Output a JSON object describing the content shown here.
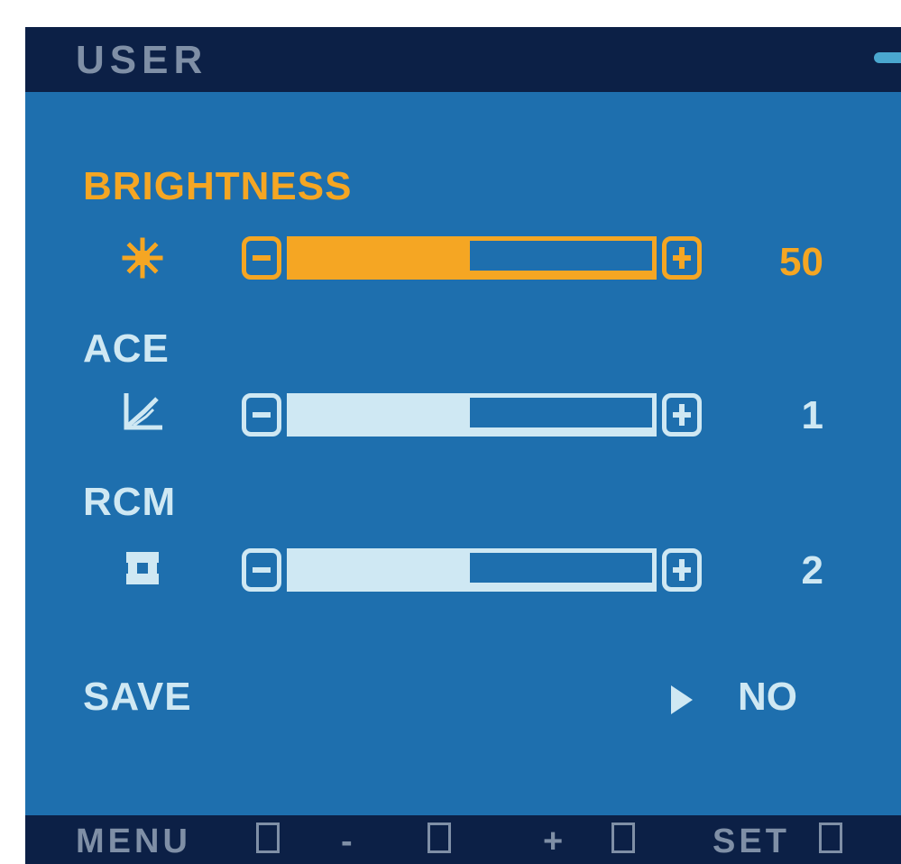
{
  "header": {
    "title": "USER"
  },
  "menu": {
    "brightness": {
      "label": "BRIGHTNESS",
      "icon": "sun-icon",
      "value": "50",
      "level": 0.5,
      "active": true
    },
    "ace": {
      "label": "ACE",
      "icon": "contrast-curve-icon",
      "value": "1",
      "level": 0.5
    },
    "rcm": {
      "label": "RCM",
      "icon": "color-square-icon",
      "value": "2",
      "level": 0.5
    },
    "save": {
      "label": "SAVE",
      "value": "NO"
    }
  },
  "footer": {
    "menu_label": "MENU",
    "set_label": "SET",
    "minus_label": "-",
    "plus_label": "+"
  },
  "colors": {
    "panel": "#1e6fae",
    "bars": "#0c2046",
    "highlight": "#f5a623",
    "text": "#cfe8f3"
  }
}
